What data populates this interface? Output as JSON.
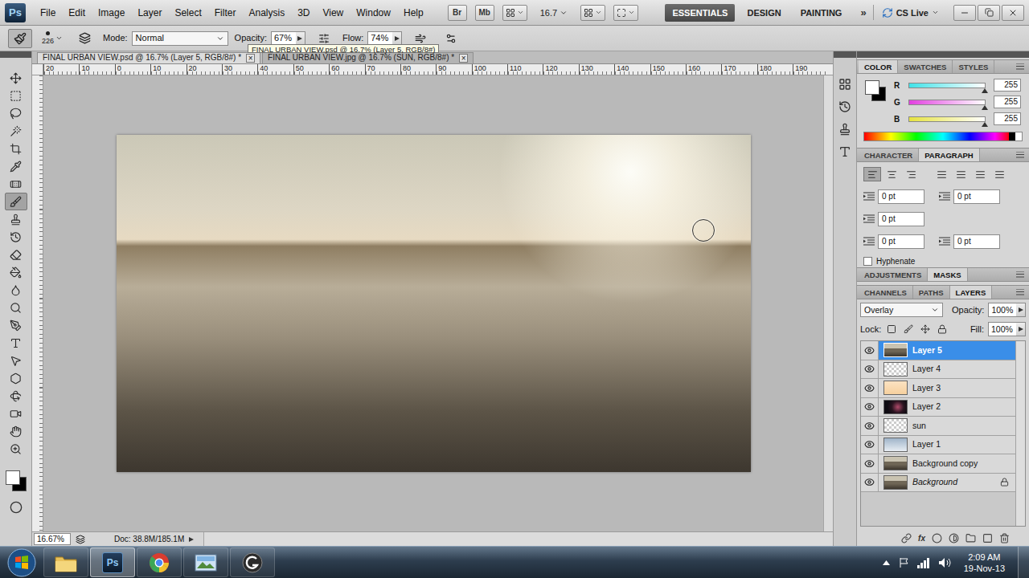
{
  "app": {
    "logo": "Ps",
    "bridge": "Br",
    "mini_bridge": "Mb",
    "zoom": "16.7"
  },
  "menu": [
    "File",
    "Edit",
    "Image",
    "Layer",
    "Select",
    "Filter",
    "Analysis",
    "3D",
    "View",
    "Window",
    "Help"
  ],
  "workspaces": [
    {
      "label": "ESSENTIALS",
      "selected": true
    },
    {
      "label": "DESIGN",
      "selected": false
    },
    {
      "label": "PAINTING",
      "selected": false
    }
  ],
  "more_workspaces": "»",
  "cs_live": "CS Live",
  "options_bar": {
    "brush_size": "226",
    "mode_label": "Mode:",
    "mode": "Normal",
    "opacity_label": "Opacity:",
    "opacity": "67%",
    "flow_label": "Flow:",
    "flow": "74%"
  },
  "tooltip": "FINAL URBAN VIEW.psd @ 16.7% (Layer 5, RGB/8#)",
  "documents": [
    {
      "title": "FINAL URBAN VIEW.psd @ 16.7% (Layer 5, RGB/8#) *",
      "selected": true,
      "close": "×"
    },
    {
      "title": "FINAL URBAN VIEW.jpg @ 16.7% (SUN, RGB/8#) *",
      "selected": false,
      "close": "×"
    }
  ],
  "tools": [
    {
      "selected": false
    },
    {
      "selected": false
    },
    {
      "selected": false
    },
    {
      "selected": false
    },
    {
      "selected": false
    },
    {
      "selected": false
    },
    {
      "selected": false
    },
    {
      "selected": true
    },
    {
      "selected": false
    },
    {
      "selected": false
    },
    {
      "selected": false
    },
    {
      "selected": false
    },
    {
      "selected": false
    },
    {
      "selected": false
    },
    {
      "selected": false
    },
    {
      "selected": false
    },
    {
      "selected": false
    },
    {
      "selected": false
    },
    {
      "selected": false
    },
    {
      "selected": false
    },
    {
      "selected": false
    },
    {
      "selected": false
    }
  ],
  "colors": {
    "foreground": "#ffffff",
    "background": "#000000"
  },
  "ruler": [
    "20",
    "10",
    "0",
    "10",
    "20",
    "30",
    "40",
    "50",
    "60",
    "70",
    "80",
    "90",
    "100",
    "110",
    "120",
    "130",
    "140",
    "150",
    "160",
    "170",
    "180",
    "190"
  ],
  "status_bar": {
    "zoom": "16.67%",
    "doc": "Doc: 38.8M/185.1M"
  },
  "color_panel": {
    "tabs": [
      {
        "label": "COLOR",
        "selected": true
      },
      {
        "label": "SWATCHES",
        "selected": false
      },
      {
        "label": "STYLES",
        "selected": false
      }
    ],
    "channels": [
      {
        "name": "R",
        "value": "255",
        "level": 1,
        "color": "#3fe2e8"
      },
      {
        "name": "G",
        "value": "255",
        "level": 1,
        "color": "#e23fe0"
      },
      {
        "name": "B",
        "value": "255",
        "level": 1,
        "color": "#e6e33f"
      }
    ]
  },
  "paragraph_panel": {
    "tabs": [
      {
        "label": "CHARACTER",
        "selected": false
      },
      {
        "label": "PARAGRAPH",
        "selected": true
      }
    ],
    "alignments": [
      {
        "selected": true
      },
      {
        "selected": false
      },
      {
        "selected": false
      },
      {
        "selected": false
      },
      {
        "selected": false
      },
      {
        "selected": false
      },
      {
        "selected": false
      }
    ],
    "fields": [
      "0 pt",
      "0 pt",
      "0 pt",
      "0 pt",
      "0 pt"
    ],
    "hyphenate": {
      "label": "Hyphenate",
      "checked": false
    }
  },
  "adjustments_panel": {
    "tabs": [
      {
        "label": "ADJUSTMENTS",
        "selected": false
      },
      {
        "label": "MASKS",
        "selected": true
      }
    ]
  },
  "layers_panel": {
    "tabs": [
      {
        "label": "CHANNELS",
        "selected": false
      },
      {
        "label": "PATHS",
        "selected": false
      },
      {
        "label": "LAYERS",
        "selected": true
      }
    ],
    "blend_mode": "Overlay",
    "opacity_label": "Opacity:",
    "opacity": "100%",
    "lock_label": "Lock:",
    "fill_label": "Fill:",
    "fill": "100%",
    "fx": "fx",
    "layers": [
      {
        "name": "Layer 5",
        "visible": true,
        "selected": true,
        "locked": false,
        "kind": "photo"
      },
      {
        "name": "Layer 4",
        "visible": true,
        "selected": false,
        "locked": false,
        "kind": "checker"
      },
      {
        "name": "Layer 3",
        "visible": true,
        "selected": false,
        "locked": false,
        "kind": "peach"
      },
      {
        "name": "Layer 2",
        "visible": true,
        "selected": false,
        "locked": false,
        "kind": "dark"
      },
      {
        "name": "sun",
        "visible": true,
        "selected": false,
        "locked": false,
        "kind": "checker"
      },
      {
        "name": "Layer 1",
        "visible": true,
        "selected": false,
        "locked": false,
        "kind": "sky"
      },
      {
        "name": "Background copy",
        "visible": true,
        "selected": false,
        "locked": false,
        "kind": "photo"
      },
      {
        "name": "Background",
        "visible": true,
        "selected": false,
        "locked": true,
        "kind": "photo"
      }
    ]
  },
  "taskbar": {
    "apps": [
      {
        "kind": "explorer",
        "selected": false
      },
      {
        "kind": "photoshop",
        "selected": true,
        "label": "Ps"
      },
      {
        "kind": "chrome",
        "selected": false
      },
      {
        "kind": "photos",
        "selected": false
      },
      {
        "kind": "app",
        "selected": false
      }
    ],
    "time": "2:09 AM",
    "date": "19-Nov-13"
  }
}
